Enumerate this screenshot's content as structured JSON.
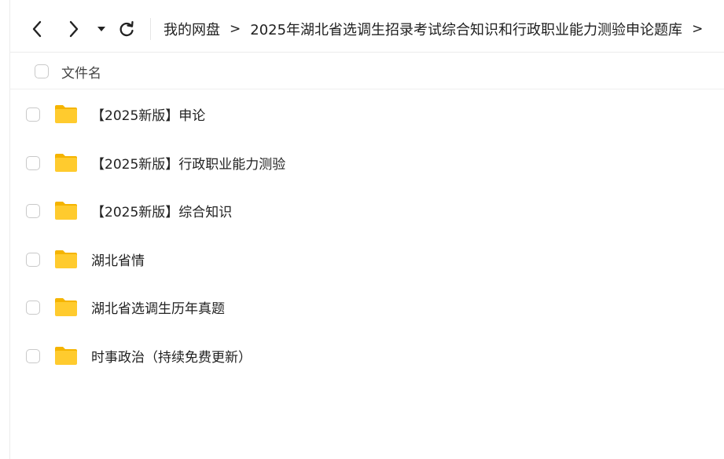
{
  "toolbar": {
    "back_icon": "chevron-left-icon",
    "forward_icon": "chevron-right-icon",
    "dropdown_icon": "triangle-down-icon",
    "refresh_icon": "refresh-icon"
  },
  "breadcrumb": {
    "items": [
      "我的网盘",
      "2025年湖北省选调生招录考试综合知识和行政职业能力测验申论题库"
    ],
    "separator": ">",
    "trailing_separator": ">"
  },
  "list_header": {
    "name_column": "文件名"
  },
  "files": [
    {
      "name": "【2025新版】申论",
      "icon": "folder-icon"
    },
    {
      "name": "【2025新版】行政职业能力测验",
      "icon": "folder-icon"
    },
    {
      "name": "【2025新版】综合知识",
      "icon": "folder-icon"
    },
    {
      "name": "湖北省情",
      "icon": "folder-icon"
    },
    {
      "name": "湖北省选调生历年真题",
      "icon": "folder-icon"
    },
    {
      "name": "时事政治（持续免费更新）",
      "icon": "folder-icon"
    }
  ],
  "colors": {
    "folder_body": "#FFCB2E",
    "folder_tab": "#F5B400",
    "border": "#ECECEC",
    "text": "#222222"
  }
}
